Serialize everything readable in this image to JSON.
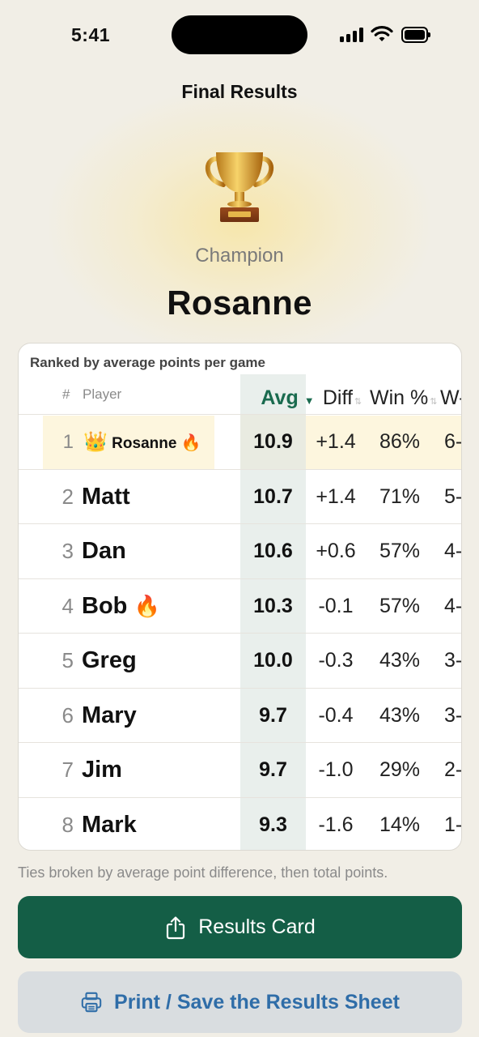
{
  "status_bar": {
    "time": "5:41"
  },
  "header": {
    "title": "Final Results"
  },
  "champion": {
    "label": "Champion",
    "name": "Rosanne",
    "trophy_icon": "trophy-icon"
  },
  "table": {
    "caption": "Ranked by average points per game",
    "columns": {
      "rank": "#",
      "player": "Player",
      "avg": "Avg",
      "avg_sort": "▼",
      "diff": "Diff",
      "diff_sort": "⇅",
      "win": "Win %",
      "win_sort": "⇅",
      "wl": "W-"
    },
    "rows": [
      {
        "rank": "1",
        "name": "Rosanne",
        "crown": "👑",
        "fire": "🔥",
        "avg": "10.9",
        "diff": "+1.4",
        "win": "86%",
        "wl": "6-"
      },
      {
        "rank": "2",
        "name": "Matt",
        "avg": "10.7",
        "diff": "+1.4",
        "win": "71%",
        "wl": "5-"
      },
      {
        "rank": "3",
        "name": "Dan",
        "avg": "10.6",
        "diff": "+0.6",
        "win": "57%",
        "wl": "4-"
      },
      {
        "rank": "4",
        "name": "Bob",
        "fire": "🔥",
        "avg": "10.3",
        "diff": "-0.1",
        "win": "57%",
        "wl": "4-"
      },
      {
        "rank": "5",
        "name": "Greg",
        "avg": "10.0",
        "diff": "-0.3",
        "win": "43%",
        "wl": "3-"
      },
      {
        "rank": "6",
        "name": "Mary",
        "avg": "9.7",
        "diff": "-0.4",
        "win": "43%",
        "wl": "3-"
      },
      {
        "rank": "7",
        "name": "Jim",
        "avg": "9.7",
        "diff": "-1.0",
        "win": "29%",
        "wl": "2-"
      },
      {
        "rank": "8",
        "name": "Mark",
        "avg": "9.3",
        "diff": "-1.6",
        "win": "14%",
        "wl": "1-"
      }
    ]
  },
  "footnote": "Ties broken by average point difference, then total points.",
  "actions": {
    "results_card": "Results Card",
    "print_sheet": "Print / Save the Results Sheet"
  },
  "colors": {
    "primary": "#145e46",
    "secondary_bg": "#d9dde0",
    "link": "#2f6da8",
    "highlight": "#fdf6de"
  }
}
